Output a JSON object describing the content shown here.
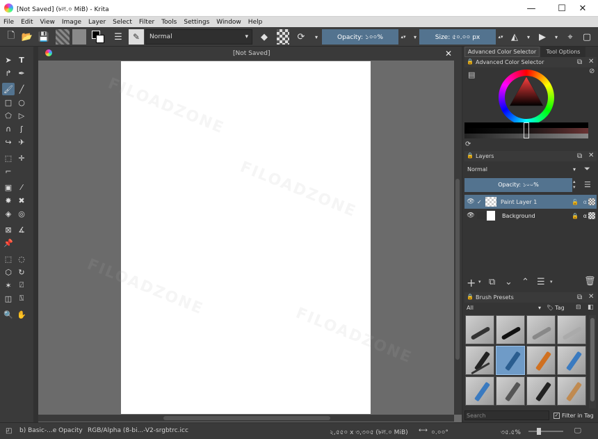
{
  "window": {
    "title": "[Not Saved]  (৳ল.০ MiB)  - Krita",
    "minimize": "—",
    "maximize": "☐",
    "close": "✕"
  },
  "menu": [
    "File",
    "Edit",
    "View",
    "Image",
    "Layer",
    "Select",
    "Filter",
    "Tools",
    "Settings",
    "Window",
    "Help"
  ],
  "toolbar": {
    "blend_mode": "Normal",
    "opacity_label": "Opacity: ১০০%",
    "size_label": "Size: ৫০.০০ px"
  },
  "document": {
    "tab_title": "[Not Saved]",
    "close": "✕"
  },
  "color_panel": {
    "tab1": "Advanced Color Selector",
    "tab2": "Tool Options",
    "title": "Advanced Color Selector"
  },
  "layers_panel": {
    "title": "Layers",
    "blend_mode": "Normal",
    "opacity_label": "Opacity: ১০০%",
    "layers": [
      {
        "name": "Paint Layer 1"
      },
      {
        "name": "Background"
      }
    ]
  },
  "brush_presets": {
    "title": "Brush Presets",
    "filter": "All",
    "tag": "Tag",
    "search_placeholder": "Search",
    "filter_in_tag": "Filter in Tag"
  },
  "status": {
    "brush": "b) Basic-...e Opacity",
    "color_profile": "RGB/Alpha (8-bi...-V2-srgbtrc.icc",
    "dimensions": "২,৫৫০ x ৩,৩০৫ (৳ল.০ MiB)",
    "rotation": "০.০০°",
    "zoom": "৩৫.৫%"
  },
  "watermark": "FILOADZONE",
  "colors": {
    "accent": "#53738f",
    "background": "#313131",
    "canvas": "#ffffff"
  }
}
